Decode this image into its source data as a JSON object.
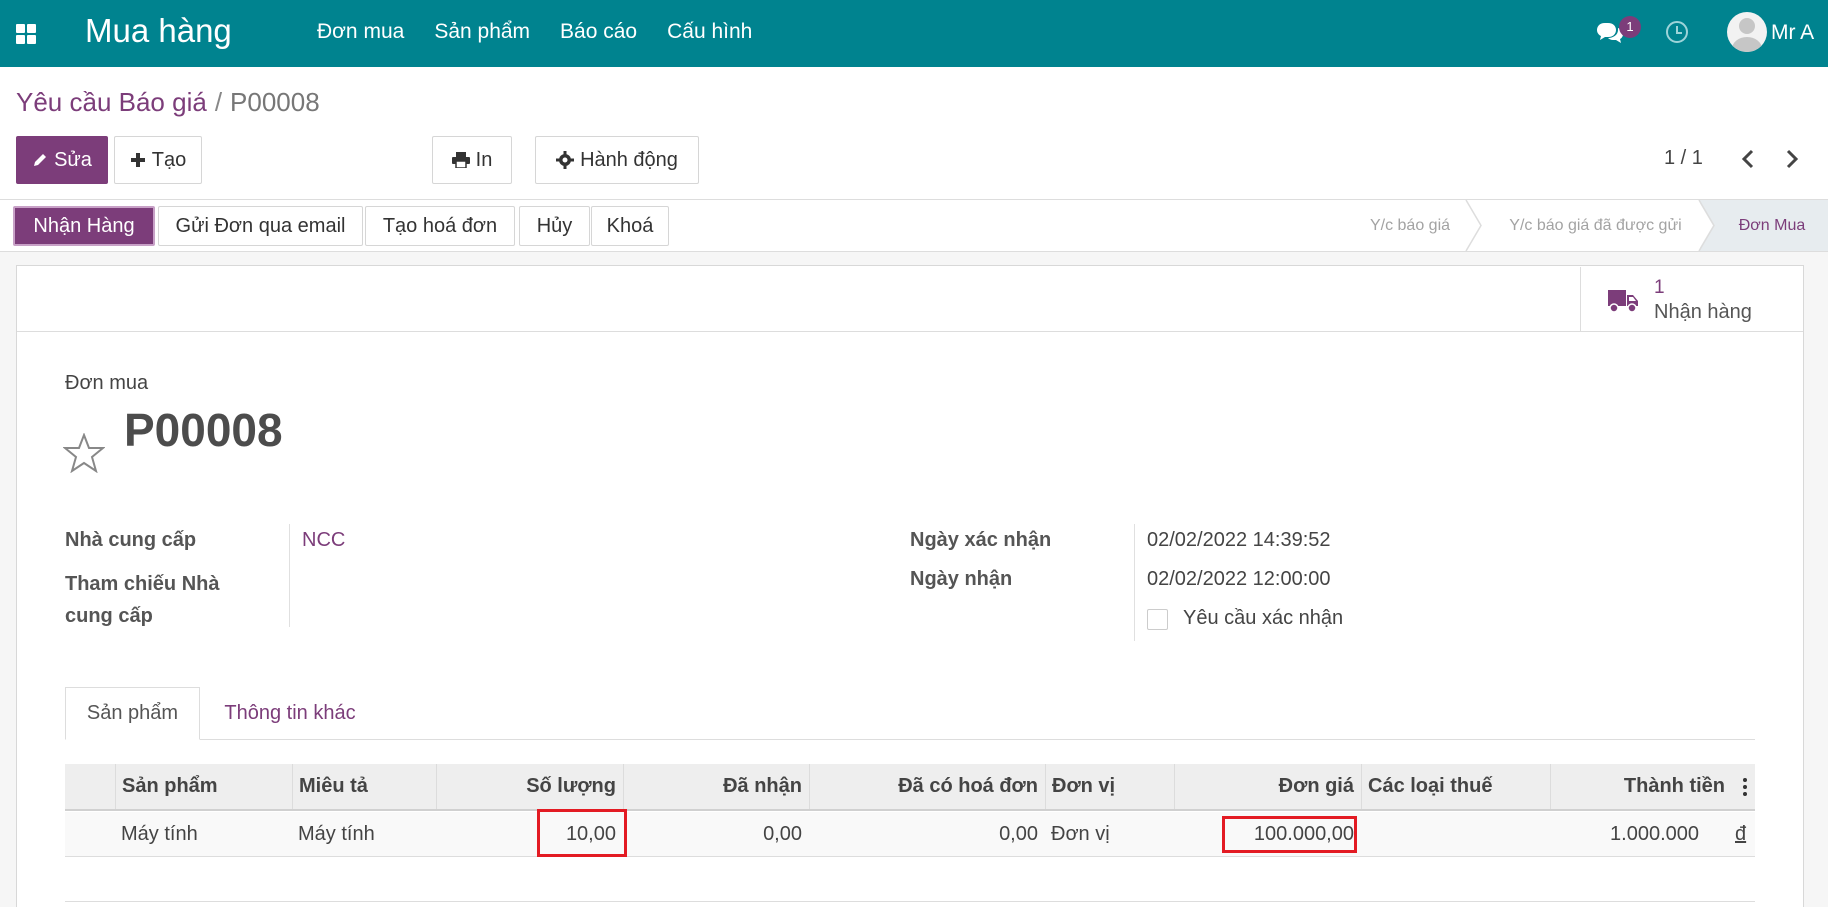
{
  "navbar": {
    "app_title": "Mua hàng",
    "menu": [
      "Đơn mua",
      "Sản phẩm",
      "Báo cáo",
      "Cấu hình"
    ],
    "chat_badge": "1",
    "user_name": "Mr A",
    "color": "#00838f"
  },
  "breadcrumb": {
    "parent": "Yêu cầu Báo giá",
    "separator": "/",
    "current": "P00008"
  },
  "toolbar": {
    "edit_label": "Sửa",
    "create_label": "Tạo",
    "print_label": "In",
    "action_label": "Hành động"
  },
  "pager": {
    "value": "1 / 1"
  },
  "statusbar": {
    "buttons": [
      "Nhận Hàng",
      "Gửi Đơn qua email",
      "Tạo hoá đơn",
      "Hủy",
      "Khoá"
    ],
    "stages": [
      "Y/c báo giá",
      "Y/c báo giá đã được gửi",
      "Đơn Mua"
    ],
    "active_stage": "Đơn Mua"
  },
  "smart_button": {
    "count": "1",
    "label": "Nhận hàng",
    "icon": "truck-icon"
  },
  "form": {
    "doc_type": "Đơn mua",
    "doc_name": "P00008",
    "left_fields": [
      {
        "label": "Nhà cung cấp",
        "value": "NCC"
      },
      {
        "label": "Tham chiếu Nhà cung cấp",
        "value": ""
      }
    ],
    "right_fields": [
      {
        "label": "Ngày xác nhận",
        "value": "02/02/2022 14:39:52"
      },
      {
        "label": "Ngày nhận",
        "value": "02/02/2022 12:00:00"
      }
    ],
    "checkbox_label": "Yêu cầu xác nhận",
    "checkbox_checked": false
  },
  "tabs": [
    "Sản phẩm",
    "Thông tin khác"
  ],
  "table": {
    "columns": [
      "Sản phẩm",
      "Miêu tả",
      "Số lượng",
      "Đã nhận",
      "Đã có hoá đơn",
      "Đơn vị",
      "Đơn giá",
      "Các loại thuế",
      "Thành tiền"
    ],
    "rows": [
      {
        "product": "Máy tính",
        "description": "Máy tính",
        "quantity": "10,00",
        "received": "0,00",
        "invoiced": "0,00",
        "uom": "Đơn vị",
        "unit_price": "100.000,00",
        "taxes": "",
        "subtotal": "1.000.000",
        "currency": "đ"
      }
    ]
  },
  "colors": {
    "accent": "#7c3d7a",
    "highlight": "#e31b23"
  }
}
